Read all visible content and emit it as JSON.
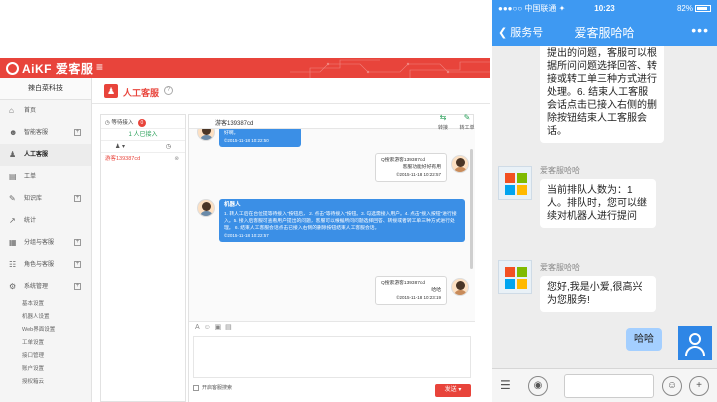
{
  "admin": {
    "brand": "AiKF 爱客服",
    "menu_toggle": "≡",
    "org_name": "辣白菜科技",
    "page_title": "人工客服",
    "nav": [
      {
        "label": "首页",
        "icon": "⌂",
        "plus": false
      },
      {
        "label": "智能客服",
        "icon": "☻",
        "plus": true
      },
      {
        "label": "人工客服",
        "icon": "♟",
        "plus": false,
        "active": true
      },
      {
        "label": "工单",
        "icon": "▤",
        "plus": false
      },
      {
        "label": "知识库",
        "icon": "✎",
        "plus": true
      },
      {
        "label": "统计",
        "icon": "↗",
        "plus": false
      },
      {
        "label": "分组与客服",
        "icon": "▦",
        "plus": true
      },
      {
        "label": "角色与客服",
        "icon": "☷",
        "plus": true
      },
      {
        "label": "系统管理",
        "icon": "⚙",
        "plus": true
      }
    ],
    "subnav": [
      "基本设置",
      "机器人设置",
      "Web界面设置",
      "工单设置",
      "接口管理",
      "账户设置",
      "授权箱云"
    ],
    "queue": {
      "waiting_label": "等待接入",
      "waiting_count": "0",
      "joined_label": "1 人已接入",
      "visitor": "游客139387cd"
    },
    "chat": {
      "visitor_name": "游客139387cd",
      "actions": [
        {
          "label": "转接",
          "icon": "⇆"
        },
        {
          "label": "转工单",
          "icon": "✎"
        }
      ],
      "send_label": "发送",
      "enter_label": "开启客服搜索",
      "messages": {
        "m0_text": "好啊。",
        "m0_time": "©2015-11-18 10:22:50",
        "m1_text": "Q搜索游客139387cd",
        "m1_sub": "客服功能好好有用",
        "m1_time": "©2015-11-18 10:22:57",
        "m2_title": "机器人",
        "m2_text": "1. 转人工后在台位提等待接入\"按钮后，  2. 点击\"等待接入\"按钮。3. 勾选需接入用户。4. 点击\"接入按钮\"进行接入。5. 接入后客服可查看用户提出的问题，客服可以根据所问问题选择回答、转接或者转工单三种方式进行处理。 6. 结束人工客服会话点击已接入右侧的删除按钮结束人工客服会话。",
        "m2_time": "©2015-11-18 10:22:57",
        "m3_text": "Q搜索游客139387cd",
        "m3_sub": "哈哈",
        "m3_time": "©2015-11-18 10:23:19"
      }
    }
  },
  "phone": {
    "status": {
      "carrier": "●●●○○ 中国联通 ✦",
      "time": "10:23",
      "battery": "82%",
      "battery_level": 0.82
    },
    "nav": {
      "back": "❮ 服务号",
      "title": "爱客服哈哈",
      "more": "•••"
    },
    "bot_name": "爱客服哈哈",
    "messages": [
      {
        "text": "提出的问题，客服可以根据所问问题选择回答、转接或转工单三种方式进行处理。6. 结束人工客服会话点击已接入右侧的删除按钮结束人工客服会话。"
      },
      {
        "text": "当前排队人数为：1人。排队时，您可以继续对机器人进行提问"
      },
      {
        "text": "您好,我是小爱,很高兴为您服务!"
      },
      {
        "text": "哈哈"
      }
    ]
  },
  "colors": {
    "brand_red": "#e8443b",
    "phone_blue": "#3e99f2",
    "chat_blue": "#3b8fe6",
    "me_bubble": "#a4cfff"
  }
}
